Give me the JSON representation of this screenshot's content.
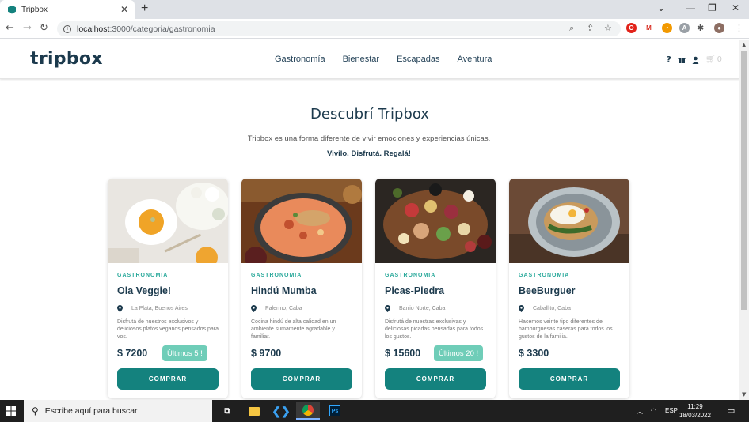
{
  "browser": {
    "tab_title": "Tripbox",
    "url_host": "localhost",
    "url_path": ":3000/categoria/gastronomia",
    "close_glyph": "✕",
    "new_tab_glyph": "+"
  },
  "site": {
    "logo": "tripbox",
    "nav": [
      "Gastronomía",
      "Bienestar",
      "Escapadas",
      "Aventura"
    ],
    "cart_count": "0",
    "help_glyph": "?",
    "accent": "#14827e",
    "badge_color": "#6fcdb8"
  },
  "hero": {
    "title": "Descubrí Tripbox",
    "subtitle": "Tripbox es una forma diferente de vivir emociones y experiencias únicas.",
    "tagline": "Vivilo. Disfrutá. Regalá!"
  },
  "cards": [
    {
      "category": "GASTRONOMIA",
      "title": "Ola Veggie!",
      "location": "La Plata, Buenos Aires",
      "description": "Disfrutá de nuestros exclusivos y deliciosos platos veganos pensados para vos.",
      "price": "$ 7200",
      "badge": "Últimos 5 !",
      "button": "COMPRAR"
    },
    {
      "category": "GASTRONOMIA",
      "title": "Hindú Mumba",
      "location": "Palermo, Caba",
      "description": "Cocina hindú de alta calidad en un ambiente sumamente agradable y familiar.",
      "price": "$ 9700",
      "badge": "",
      "button": "COMPRAR"
    },
    {
      "category": "GASTRONOMIA",
      "title": "Picas-Piedra",
      "location": "Barrio Norte, Caba",
      "description": "Disfrutá de nuestras exclusivas y deliciosas picadas pensadas para todos los gustos.",
      "price": "$ 15600",
      "badge": "Últimos 20 !",
      "button": "COMPRAR"
    },
    {
      "category": "GASTRONOMIA",
      "title": "BeeBurguer",
      "location": "Caballito, Caba",
      "description": "Hacemos veinte tipo diferentes de hamburguesas caseras para todos los gustos de la familia.",
      "price": "$ 3300",
      "badge": "",
      "button": "COMPRAR"
    }
  ],
  "taskbar": {
    "search_placeholder": "Escribe aquí para buscar",
    "lang": "ESP",
    "time": "11:29",
    "date": "18/03/2022"
  }
}
